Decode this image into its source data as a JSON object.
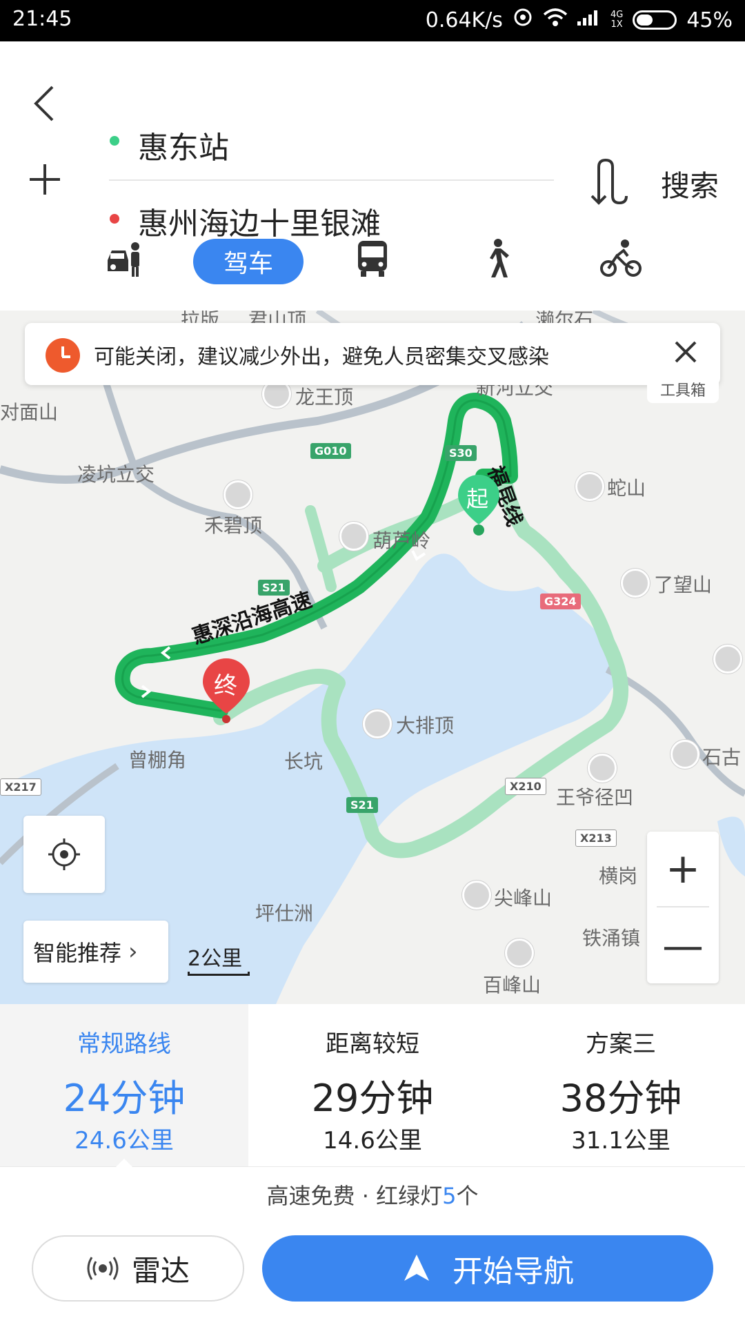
{
  "status_bar": {
    "time": "21:45",
    "network_speed": "0.64K/s",
    "signal_label_top": "4G",
    "signal_label_bottom": "1X",
    "battery_percent": "45%",
    "battery_level": 0.45
  },
  "header": {
    "origin": "惠东站",
    "destination": "惠州海边十里银滩",
    "search_label": "搜索",
    "icons": {
      "back": "back-arrow-icon",
      "add": "plus-icon",
      "swap": "swap-icon"
    }
  },
  "modes": {
    "drive_label": "驾车",
    "icons": [
      "taxi-icon",
      "bus-icon",
      "walk-icon",
      "bike-icon"
    ]
  },
  "notice": {
    "text": "可能关闭，建议减少外出，避免人员密集交叉感染"
  },
  "toolbox_peek": "工具箱",
  "map": {
    "labels": {
      "top1": "拉版",
      "top2": "君山顶",
      "top3": "濑尔石",
      "duimian": "对面山",
      "longwang": "龙王顶",
      "xinhu": "新河立交",
      "lingkeng": "凌坑立交",
      "heblingding": "禾碧顶",
      "hululing": "葫芦岭",
      "shanshan": "蛇山",
      "liaowang": "了望山",
      "dapaiding": "大排顶",
      "shigu": "石古",
      "zengpeng": "曾棚角",
      "changkeng": "长坑",
      "wangye": "王爷径凹",
      "henggang": "横岗",
      "jianfeng": "尖峰山",
      "pingshi": "坪仕洲",
      "tieyong": "铁涌镇",
      "baifeng": "百峰山",
      "road_huishen": "惠深沿海高速",
      "road_fukun": "福昆线"
    },
    "shields": {
      "g010": "G010",
      "s30": "S30",
      "s21a": "S21",
      "g324": "G324",
      "s21b": "S21",
      "x210": "X210",
      "x213": "X213",
      "x217": "X217"
    },
    "markers": {
      "start": "起",
      "end": "终"
    },
    "route_colors": {
      "primary": "#1fb45b",
      "alternative": "#a9e2c0"
    }
  },
  "controls": {
    "smart_recommend": "智能推荐",
    "scale": "2公里",
    "zoom_in": "+",
    "zoom_out": "—"
  },
  "routes": [
    {
      "name": "常规路线",
      "time": "24分钟",
      "distance": "24.6公里"
    },
    {
      "name": "距离较短",
      "time": "29分钟",
      "distance": "14.6公里"
    },
    {
      "name": "方案三",
      "time": "38分钟",
      "distance": "31.1公里"
    }
  ],
  "info": {
    "prefix": "高速免费 · 红绿灯",
    "lights": "5",
    "suffix": "个"
  },
  "actions": {
    "radar": "雷达",
    "navigate": "开始导航"
  },
  "colors": {
    "accent": "#3a86f0",
    "notice": "#ee5a2d"
  }
}
